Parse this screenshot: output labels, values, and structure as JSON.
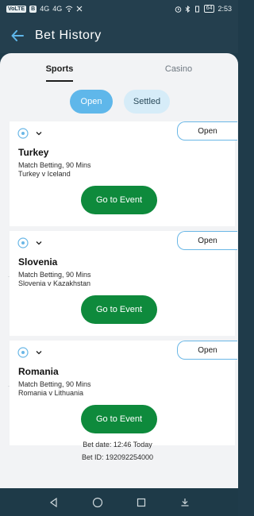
{
  "status_bar": {
    "left_chips": [
      "VoLTE",
      "B",
      "4G",
      "4G"
    ],
    "battery": "64",
    "time": "2:53"
  },
  "header": {
    "title": "Bet History",
    "back_icon": "arrow-left-icon"
  },
  "tabs": [
    {
      "label": "Sports",
      "active": true
    },
    {
      "label": "Casino",
      "active": false
    }
  ],
  "filters": [
    {
      "label": "Open",
      "active": true
    },
    {
      "label": "Settled",
      "active": false
    }
  ],
  "bets": [
    {
      "status": "Open",
      "selection": "Turkey",
      "market": "Match Betting, 90 Mins",
      "event": "Turkey v Iceland",
      "button": "Go to Event",
      "sport_icon": "football-icon"
    },
    {
      "status": "Open",
      "selection": "Slovenia",
      "market": "Match Betting, 90 Mins",
      "event": "Slovenia v Kazakhstan",
      "button": "Go to Event",
      "sport_icon": "football-icon"
    },
    {
      "status": "Open",
      "selection": "Romania",
      "market": "Match Betting, 90 Mins",
      "event": "Romania v Lithuania",
      "button": "Go to Event",
      "sport_icon": "football-icon"
    }
  ],
  "bet_meta": {
    "date": "Bet date: 12:46 Today",
    "id": "Bet ID: 192092254000"
  },
  "colors": {
    "header_bg": "#243f4e",
    "accent_blue": "#5fb7ea",
    "cta_green": "#0e8a3c"
  }
}
